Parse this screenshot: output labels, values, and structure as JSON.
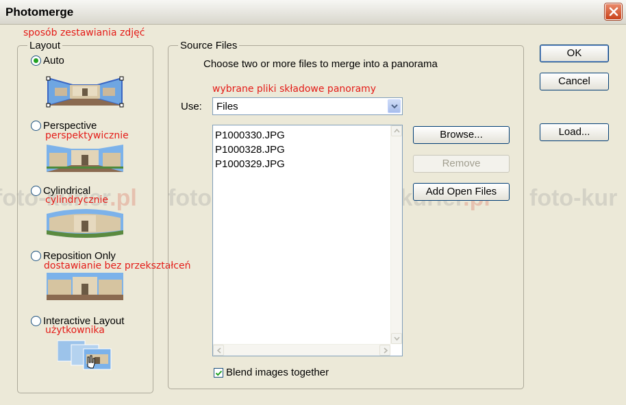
{
  "window": {
    "title": "Photomerge"
  },
  "annotations": {
    "layout_note": "sposób zestawiania zdjęć",
    "perspective_note": "perspektywicznie",
    "cylindrical_note": "cylindrycznie",
    "reposition_note": "dostawianie bez przekształceń",
    "interactive_note": "użytkownika",
    "files_note": "wybrane pliki składowe panoramy"
  },
  "watermark": {
    "text": "foto-kurier",
    "suffix": ".pl",
    "partial": "foto-kur"
  },
  "layout": {
    "legend": "Layout",
    "options": [
      {
        "label": "Auto",
        "checked": true
      },
      {
        "label": "Perspective",
        "checked": false
      },
      {
        "label": "Cylindrical",
        "checked": false
      },
      {
        "label": "Reposition Only",
        "checked": false
      },
      {
        "label": "Interactive Layout",
        "checked": false
      }
    ]
  },
  "source": {
    "legend": "Source Files",
    "instruction": "Choose two or more files to merge into a panorama",
    "use_label": "Use:",
    "use_value": "Files",
    "files": [
      "P1000330.JPG",
      "P1000328.JPG",
      "P1000329.JPG"
    ],
    "browse_label": "Browse...",
    "remove_label": "Remove",
    "add_open_label": "Add Open Files",
    "blend_label": "Blend images together",
    "blend_checked": true
  },
  "buttons": {
    "ok": "OK",
    "cancel": "Cancel",
    "load": "Load..."
  },
  "colors": {
    "annotation": "#e41b17",
    "radio_dot": "#21a121",
    "dialog_bg": "#ece9d8"
  }
}
